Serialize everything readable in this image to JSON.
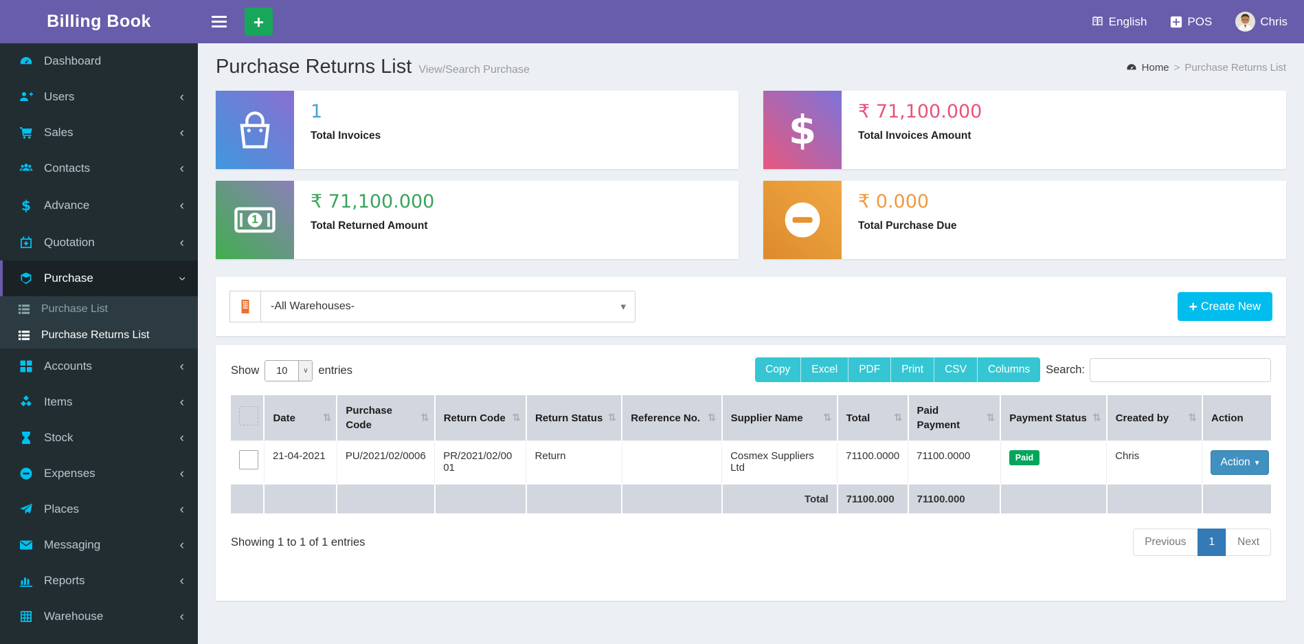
{
  "app": {
    "title": "Billing Book"
  },
  "header": {
    "language": "English",
    "pos_label": "POS",
    "user_name": "Chris"
  },
  "sidebar": {
    "items": [
      {
        "label": "Dashboard",
        "icon": "dashboard-icon"
      },
      {
        "label": "Users",
        "icon": "user-plus-icon"
      },
      {
        "label": "Sales",
        "icon": "cart-icon"
      },
      {
        "label": "Contacts",
        "icon": "contacts-icon"
      },
      {
        "label": "Advance",
        "icon": "dollar-icon"
      },
      {
        "label": "Quotation",
        "icon": "calendar-plus-icon"
      },
      {
        "label": "Purchase",
        "icon": "cube-icon",
        "active": true,
        "submenu": [
          {
            "label": "Purchase List",
            "icon": "list-icon"
          },
          {
            "label": "Purchase Returns List",
            "icon": "list-icon",
            "active": true
          }
        ]
      },
      {
        "label": "Accounts",
        "icon": "grid-icon"
      },
      {
        "label": "Items",
        "icon": "cubes-icon"
      },
      {
        "label": "Stock",
        "icon": "hourglass-icon"
      },
      {
        "label": "Expenses",
        "icon": "minus-circle-icon"
      },
      {
        "label": "Places",
        "icon": "paper-plane-icon"
      },
      {
        "label": "Messaging",
        "icon": "envelope-icon"
      },
      {
        "label": "Reports",
        "icon": "bar-chart-icon"
      },
      {
        "label": "Warehouse",
        "icon": "warehouse-icon"
      }
    ]
  },
  "page": {
    "title": "Purchase Returns List",
    "subtitle": "View/Search Purchase",
    "breadcrumb": {
      "home": "Home",
      "separator": ">",
      "current": "Purchase Returns List"
    }
  },
  "stats": [
    {
      "value": "1",
      "label": "Total Invoices",
      "icon": "shopping-bag-icon",
      "value_color": "#41a1d7"
    },
    {
      "value": "₹ 71,100.000",
      "label": "Total Invoices Amount",
      "icon": "dollar-icon",
      "value_color": "#e8537a"
    },
    {
      "value": "₹ 71,100.000",
      "label": "Total Returned Amount",
      "icon": "money-bill-icon",
      "value_color": "#3aa35b"
    },
    {
      "value": "₹ 0.000",
      "label": "Total Purchase Due",
      "icon": "minus-circle-icon",
      "value_color": "#f0993f"
    }
  ],
  "filter": {
    "warehouse_selected": "-All Warehouses-",
    "create_new_label": "Create New"
  },
  "controls": {
    "show_label": "Show",
    "page_length": "10",
    "entries_label": "entries",
    "export_buttons": [
      "Copy",
      "Excel",
      "PDF",
      "Print",
      "CSV",
      "Columns"
    ],
    "search_label": "Search:",
    "search_value": ""
  },
  "table": {
    "columns": [
      {
        "label": "",
        "sortable": false
      },
      {
        "label": "Date",
        "sortable": true
      },
      {
        "label": "Purchase Code",
        "sortable": true
      },
      {
        "label": "Return Code",
        "sortable": true
      },
      {
        "label": "Return Status",
        "sortable": true
      },
      {
        "label": "Reference No.",
        "sortable": true
      },
      {
        "label": "Supplier Name",
        "sortable": true
      },
      {
        "label": "Total",
        "sortable": true
      },
      {
        "label": "Paid Payment",
        "sortable": true
      },
      {
        "label": "Payment Status",
        "sortable": true
      },
      {
        "label": "Created by",
        "sortable": true
      },
      {
        "label": "Action",
        "sortable": false
      }
    ],
    "row": {
      "date": "21-04-2021",
      "purchase_code": "PU/2021/02/0006",
      "return_code": "PR/2021/02/0001",
      "return_status": "Return",
      "reference_no": "",
      "supplier_name": "Cosmex Suppliers Ltd",
      "total": "71100.0000",
      "paid_payment": "71100.0000",
      "payment_status": "Paid",
      "created_by": "Chris",
      "action_label": "Action"
    },
    "footer": {
      "label": "Total",
      "total": "71100.000",
      "paid_payment": "71100.000"
    }
  },
  "footerbar": {
    "info": "Showing 1 to 1 of 1 entries",
    "prev": "Previous",
    "page": "1",
    "next": "Next"
  },
  "colors": {
    "header": "#685dab",
    "sidebar": "#222d32",
    "sidebar_icon": "#00c0ef",
    "accent_teal": "#36c6d3",
    "create_button": "#00bdee",
    "action_button": "#4090c0",
    "paid_badge": "#00a65a",
    "pagination_active": "#337ab7"
  }
}
